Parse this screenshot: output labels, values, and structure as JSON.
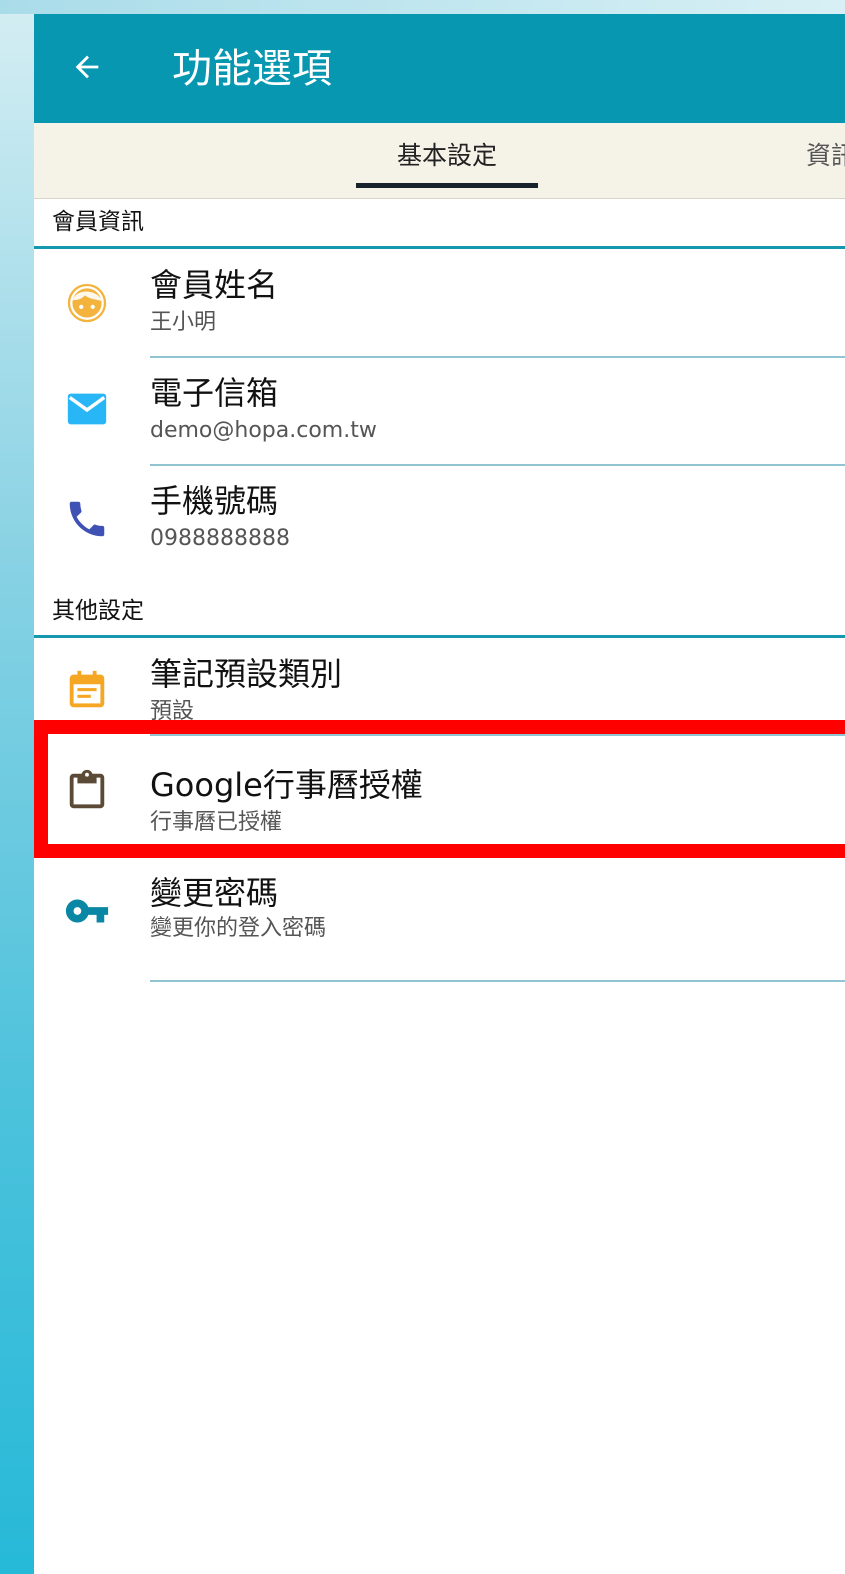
{
  "appbar": {
    "back_icon": "arrow-left-icon",
    "title": "功能選項"
  },
  "tabs": [
    {
      "label": "基本設定",
      "selected": true
    },
    {
      "label": "資訊",
      "selected": false
    }
  ],
  "sections": [
    {
      "header": "會員資訊",
      "items": [
        {
          "icon": "face-icon",
          "title": "會員姓名",
          "subtitle": "王小明"
        },
        {
          "icon": "email-icon",
          "title": "電子信箱",
          "subtitle": "demo@hopa.com.tw"
        },
        {
          "icon": "phone-icon",
          "title": "手機號碼",
          "subtitle": "0988888888"
        }
      ]
    },
    {
      "header": "其他設定",
      "items": [
        {
          "icon": "calendar-icon",
          "title": "筆記預設類別",
          "subtitle": "預設"
        },
        {
          "icon": "clipboard-icon",
          "title": "Google行事曆授權",
          "subtitle": "行事曆已授權"
        },
        {
          "icon": "key-icon",
          "title": "變更密碼",
          "subtitle": "變更你的登入密碼"
        }
      ]
    }
  ],
  "colors": {
    "appbar": "#0797b1",
    "tabbar": "#f5f2e8",
    "section_line": "#1597ad",
    "highlight": "#ff0000",
    "face_icon": "#f3b33d",
    "email_icon": "#29b6f6",
    "phone_icon": "#3f51b5",
    "calendar_icon": "#f5a623",
    "clipboard_icon": "#5b4a36",
    "key_icon": "#0a87a4"
  }
}
